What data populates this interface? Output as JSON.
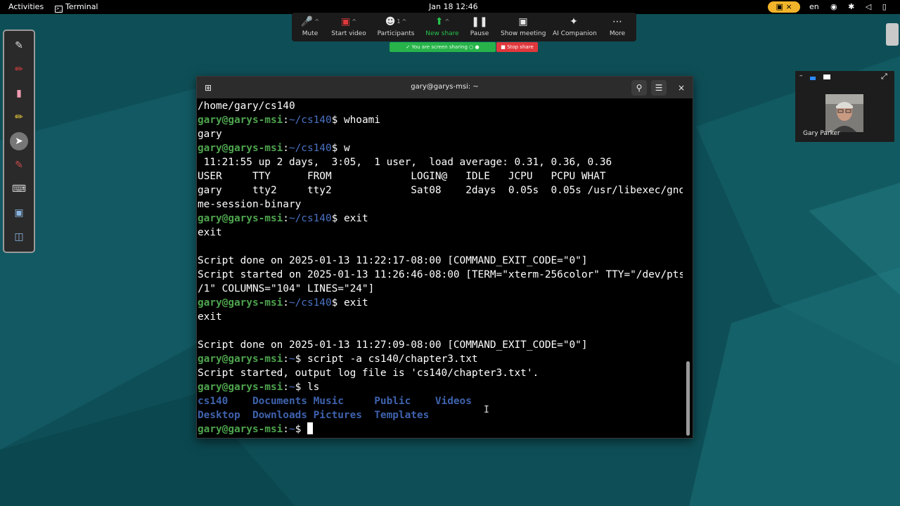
{
  "topbar": {
    "activities": "Activities",
    "app_name": "Terminal",
    "clock": "Jan 18  12:46",
    "language": "en",
    "status_icons": "◉ ✱ ◁ ▯"
  },
  "zoom": {
    "mute": "Mute",
    "start_video": "Start video",
    "participants": "Participants",
    "participants_count": "1",
    "new_share": "New share",
    "pause": "Pause",
    "show_meeting": "Show meeting",
    "ai_companion": "AI Companion",
    "more": "More",
    "sharing_status": "You are screen sharing",
    "stop_share": "Stop share"
  },
  "terminal": {
    "title": "gary@garys-msi: ~",
    "lines": [
      {
        "text": "/home/gary/cs140"
      },
      {
        "user": "gary@garys-msi",
        "path": "~/cs140",
        "cmd": "$ whoami"
      },
      {
        "text": "gary"
      },
      {
        "user": "gary@garys-msi",
        "path": "~/cs140",
        "cmd": "$ w"
      },
      {
        "text": " 11:21:55 up 2 days,  3:05,  1 user,  load average: 0.31, 0.36, 0.36"
      },
      {
        "text": "USER     TTY      FROM             LOGIN@   IDLE   JCPU   PCPU WHAT"
      },
      {
        "text": "gary     tty2     tty2             Sat08    2days  0.05s  0.05s /usr/libexec/gno"
      },
      {
        "text": "me-session-binary"
      },
      {
        "user": "gary@garys-msi",
        "path": "~/cs140",
        "cmd": "$ exit"
      },
      {
        "text": "exit"
      },
      {
        "text": ""
      },
      {
        "text": "Script done on 2025-01-13 11:22:17-08:00 [COMMAND_EXIT_CODE=\"0\"]"
      },
      {
        "text": "Script started on 2025-01-13 11:26:46-08:00 [TERM=\"xterm-256color\" TTY=\"/dev/pts"
      },
      {
        "text": "/1\" COLUMNS=\"104\" LINES=\"24\"]"
      },
      {
        "user": "gary@garys-msi",
        "path": "~/cs140",
        "cmd": "$ exit"
      },
      {
        "text": "exit"
      },
      {
        "text": ""
      },
      {
        "text": "Script done on 2025-01-13 11:27:09-08:00 [COMMAND_EXIT_CODE=\"0\"]"
      },
      {
        "user": "gary@garys-msi",
        "path": "~",
        "cmd": "$ script -a cs140/chapter3.txt"
      },
      {
        "text": "Script started, output log file is 'cs140/chapter3.txt'."
      },
      {
        "user": "gary@garys-msi",
        "path": "~",
        "cmd": "$ ls"
      }
    ],
    "ls_rows": [
      [
        "cs140   ",
        " Documents",
        " Music    ",
        " Public   ",
        " Videos"
      ],
      [
        "Desktop ",
        " Downloads",
        " Pictures ",
        " Templates",
        ""
      ]
    ],
    "final_prompt": {
      "user": "gary@garys-msi",
      "path": "~",
      "cmd": "$ "
    }
  },
  "video": {
    "participant_name": "Gary Parker"
  }
}
